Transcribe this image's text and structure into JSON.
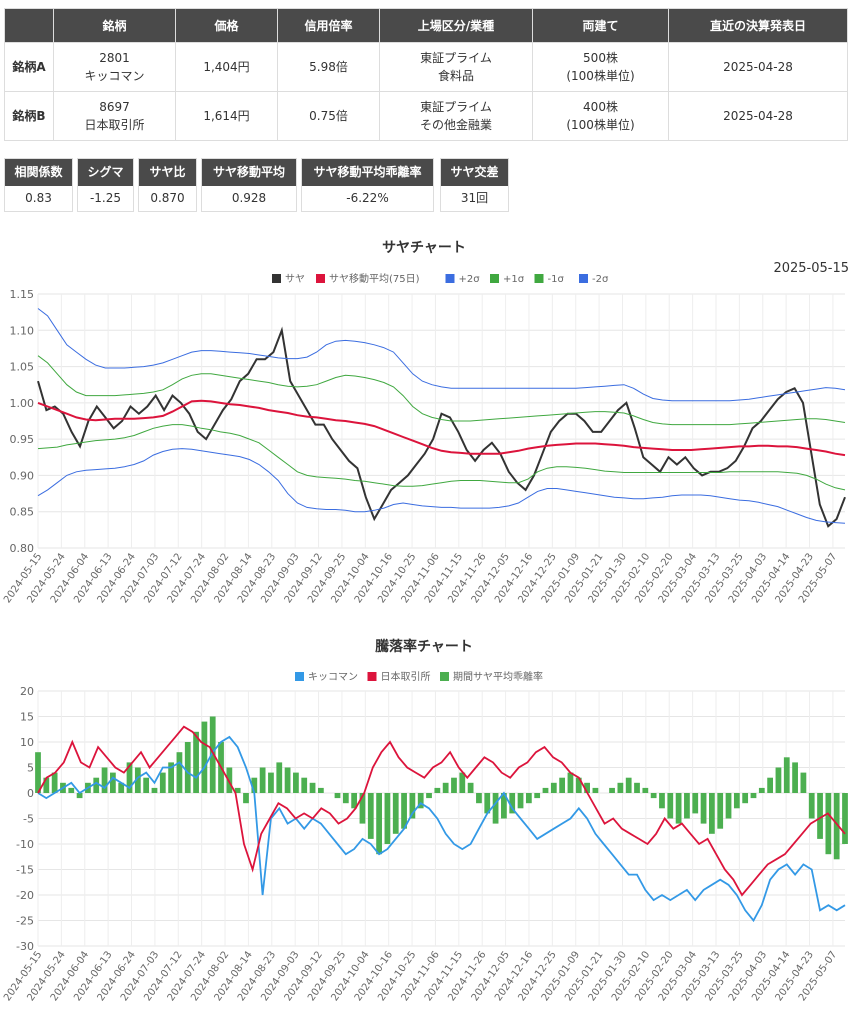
{
  "table": {
    "headers": [
      "",
      "銘柄",
      "価格",
      "信用倍率",
      "上場区分/業種",
      "両建て",
      "直近の決算発表日"
    ],
    "rows": [
      {
        "label": "銘柄A",
        "code": "2801",
        "name": "キッコマン",
        "price": "1,404円",
        "margin": "5.98倍",
        "market": "東証プライム",
        "sector": "食料品",
        "shares": "500株",
        "unit": "(100株単位)",
        "date": "2025-04-28"
      },
      {
        "label": "銘柄B",
        "code": "8697",
        "name": "日本取引所",
        "price": "1,614円",
        "margin": "0.75倍",
        "market": "東証プライム",
        "sector": "その他金融業",
        "shares": "400株",
        "unit": "(100株単位)",
        "date": "2025-04-28"
      }
    ]
  },
  "stats": [
    {
      "label": "相関係数",
      "value": "0.83"
    },
    {
      "label": "シグマ",
      "value": "-1.25"
    },
    {
      "label": "サヤ比",
      "value": "0.870"
    },
    {
      "label": "サヤ移動平均",
      "value": "0.928"
    },
    {
      "label": "サヤ移動平均乖離率",
      "value": "-6.22%"
    },
    {
      "label": "サヤ交差",
      "value": "31回"
    }
  ],
  "chart_data": [
    {
      "type": "line",
      "title": "サヤチャート",
      "date_label": "2025-05-15",
      "ylim": [
        0.8,
        1.15
      ],
      "yticks": [
        "0.80",
        "0.85",
        "0.90",
        "0.95",
        "1.00",
        "1.05",
        "1.10",
        "1.15"
      ],
      "x_labels": [
        "2024-05-15",
        "2024-05-24",
        "2024-06-04",
        "2024-06-13",
        "2024-06-24",
        "2024-07-03",
        "2024-07-12",
        "2024-07-24",
        "2024-08-02",
        "2024-08-14",
        "2024-08-23",
        "2024-09-03",
        "2024-09-12",
        "2024-09-25",
        "2024-10-04",
        "2024-10-16",
        "2024-10-25",
        "2024-11-06",
        "2024-11-15",
        "2024-11-26",
        "2024-12-05",
        "2024-12-16",
        "2024-12-25",
        "2025-01-09",
        "2025-01-21",
        "2025-01-30",
        "2025-02-10",
        "2025-02-20",
        "2025-03-04",
        "2025-03-13",
        "2025-03-25",
        "2025-04-03",
        "2025-04-14",
        "2025-04-23",
        "2025-05-07"
      ],
      "grid": true,
      "legend": "top",
      "series": [
        {
          "name": "サヤ",
          "color": "#333333",
          "values": [
            1.03,
            0.99,
            0.995,
            0.985,
            0.96,
            0.94,
            0.975,
            0.995,
            0.98,
            0.965,
            0.975,
            0.995,
            0.985,
            0.995,
            1.01,
            0.99,
            1.01,
            1.0,
            0.985,
            0.96,
            0.95,
            0.97,
            0.99,
            1.005,
            1.03,
            1.04,
            1.06,
            1.06,
            1.07,
            1.1,
            1.03,
            1.01,
            0.99,
            0.97,
            0.97,
            0.95,
            0.935,
            0.92,
            0.91,
            0.87,
            0.84,
            0.86,
            0.88,
            0.89,
            0.9,
            0.915,
            0.93,
            0.95,
            0.985,
            0.98,
            0.96,
            0.935,
            0.92,
            0.935,
            0.945,
            0.93,
            0.905,
            0.89,
            0.88,
            0.9,
            0.93,
            0.96,
            0.975,
            0.985,
            0.985,
            0.975,
            0.96,
            0.96,
            0.975,
            0.99,
            1.0,
            0.965,
            0.925,
            0.915,
            0.905,
            0.925,
            0.915,
            0.925,
            0.91,
            0.9,
            0.905,
            0.905,
            0.91,
            0.92,
            0.94,
            0.965,
            0.975,
            0.99,
            1.005,
            1.015,
            1.02,
            1.0,
            0.93,
            0.86,
            0.83,
            0.84,
            0.87
          ]
        },
        {
          "name": "サヤ移動平均(75日)",
          "color": "#dc143c",
          "values": [
            1.0,
            0.995,
            0.99,
            0.985,
            0.98,
            0.977,
            0.976,
            0.977,
            0.978,
            0.978,
            0.978,
            0.979,
            0.98,
            0.982,
            0.988,
            0.995,
            1.002,
            1.003,
            1.002,
            1.0,
            0.998,
            0.997,
            0.995,
            0.993,
            0.99,
            0.988,
            0.986,
            0.983,
            0.981,
            0.98,
            0.978,
            0.976,
            0.975,
            0.973,
            0.971,
            0.968,
            0.963,
            0.958,
            0.953,
            0.948,
            0.943,
            0.938,
            0.934,
            0.932,
            0.931,
            0.93,
            0.93,
            0.93,
            0.93,
            0.932,
            0.934,
            0.937,
            0.939,
            0.941,
            0.942,
            0.943,
            0.944,
            0.944,
            0.944,
            0.943,
            0.942,
            0.941,
            0.939,
            0.938,
            0.937,
            0.936,
            0.935,
            0.935,
            0.935,
            0.936,
            0.937,
            0.938,
            0.939,
            0.94,
            0.94,
            0.941,
            0.941,
            0.94,
            0.94,
            0.939,
            0.937,
            0.935,
            0.933,
            0.93,
            0.928
          ]
        },
        {
          "name": "+2σ",
          "color": "#3b6de0",
          "values": [
            1.13,
            1.12,
            1.1,
            1.08,
            1.07,
            1.06,
            1.052,
            1.048,
            1.048,
            1.048,
            1.049,
            1.05,
            1.052,
            1.055,
            1.06,
            1.065,
            1.07,
            1.072,
            1.072,
            1.071,
            1.07,
            1.069,
            1.068,
            1.066,
            1.064,
            1.062,
            1.061,
            1.061,
            1.063,
            1.07,
            1.08,
            1.085,
            1.086,
            1.085,
            1.083,
            1.08,
            1.076,
            1.07,
            1.055,
            1.04,
            1.03,
            1.025,
            1.022,
            1.02,
            1.02,
            1.02,
            1.02,
            1.02,
            1.02,
            1.02,
            1.02,
            1.02,
            1.02,
            1.02,
            1.02,
            1.02,
            1.02,
            1.021,
            1.022,
            1.023,
            1.024,
            1.025,
            1.02,
            1.012,
            1.006,
            1.004,
            1.003,
            1.003,
            1.003,
            1.003,
            1.003,
            1.003,
            1.003,
            1.004,
            1.005,
            1.007,
            1.009,
            1.011,
            1.013,
            1.015,
            1.017,
            1.019,
            1.021,
            1.02,
            1.018
          ]
        },
        {
          "name": "+1σ",
          "color": "#40a840",
          "values": [
            1.065,
            1.055,
            1.04,
            1.025,
            1.015,
            1.01,
            1.01,
            1.01,
            1.01,
            1.011,
            1.012,
            1.013,
            1.015,
            1.018,
            1.025,
            1.033,
            1.038,
            1.04,
            1.04,
            1.038,
            1.036,
            1.034,
            1.032,
            1.03,
            1.028,
            1.025,
            1.023,
            1.022,
            1.023,
            1.025,
            1.03,
            1.035,
            1.038,
            1.037,
            1.035,
            1.032,
            1.028,
            1.022,
            1.01,
            0.995,
            0.985,
            0.98,
            0.977,
            0.975,
            0.975,
            0.975,
            0.976,
            0.977,
            0.978,
            0.979,
            0.98,
            0.981,
            0.982,
            0.983,
            0.984,
            0.985,
            0.986,
            0.987,
            0.988,
            0.988,
            0.987,
            0.986,
            0.982,
            0.977,
            0.973,
            0.971,
            0.97,
            0.97,
            0.97,
            0.97,
            0.97,
            0.97,
            0.97,
            0.971,
            0.972,
            0.973,
            0.974,
            0.975,
            0.976,
            0.977,
            0.978,
            0.978,
            0.977,
            0.975,
            0.973
          ]
        },
        {
          "name": "-1σ",
          "color": "#40a840",
          "values": [
            0.937,
            0.938,
            0.939,
            0.942,
            0.944,
            0.946,
            0.948,
            0.949,
            0.95,
            0.952,
            0.955,
            0.96,
            0.965,
            0.968,
            0.97,
            0.97,
            0.968,
            0.965,
            0.963,
            0.96,
            0.958,
            0.955,
            0.95,
            0.945,
            0.935,
            0.925,
            0.915,
            0.905,
            0.9,
            0.898,
            0.897,
            0.896,
            0.895,
            0.893,
            0.892,
            0.89,
            0.888,
            0.886,
            0.885,
            0.885,
            0.886,
            0.888,
            0.89,
            0.892,
            0.893,
            0.893,
            0.893,
            0.892,
            0.891,
            0.89,
            0.89,
            0.895,
            0.905,
            0.91,
            0.912,
            0.912,
            0.911,
            0.91,
            0.908,
            0.906,
            0.905,
            0.904,
            0.904,
            0.904,
            0.904,
            0.904,
            0.904,
            0.904,
            0.904,
            0.904,
            0.904,
            0.904,
            0.905,
            0.905,
            0.905,
            0.905,
            0.905,
            0.905,
            0.904,
            0.903,
            0.9,
            0.895,
            0.888,
            0.883,
            0.88
          ]
        },
        {
          "name": "-2σ",
          "color": "#3b6de0",
          "values": [
            0.872,
            0.88,
            0.89,
            0.9,
            0.905,
            0.907,
            0.908,
            0.909,
            0.91,
            0.912,
            0.915,
            0.92,
            0.928,
            0.933,
            0.936,
            0.937,
            0.936,
            0.934,
            0.932,
            0.93,
            0.928,
            0.926,
            0.922,
            0.915,
            0.905,
            0.893,
            0.875,
            0.862,
            0.856,
            0.854,
            0.853,
            0.853,
            0.852,
            0.85,
            0.85,
            0.852,
            0.855,
            0.86,
            0.862,
            0.86,
            0.858,
            0.857,
            0.856,
            0.856,
            0.855,
            0.855,
            0.855,
            0.855,
            0.856,
            0.858,
            0.862,
            0.87,
            0.878,
            0.882,
            0.882,
            0.88,
            0.878,
            0.876,
            0.874,
            0.872,
            0.87,
            0.869,
            0.868,
            0.868,
            0.869,
            0.87,
            0.872,
            0.873,
            0.873,
            0.873,
            0.872,
            0.87,
            0.868,
            0.866,
            0.865,
            0.863,
            0.86,
            0.857,
            0.852,
            0.847,
            0.842,
            0.838,
            0.836,
            0.835,
            0.834
          ]
        }
      ]
    },
    {
      "type": "line",
      "title": "騰落率チャート",
      "ylim": [
        -30,
        20
      ],
      "yticks": [
        "-30",
        "-25",
        "-20",
        "-15",
        "-10",
        "-5",
        "0",
        "5",
        "10",
        "15",
        "20"
      ],
      "x_labels": [
        "2024-05-15",
        "2024-05-24",
        "2024-06-04",
        "2024-06-13",
        "2024-06-24",
        "2024-07-03",
        "2024-07-12",
        "2024-07-24",
        "2024-08-02",
        "2024-08-14",
        "2024-08-23",
        "2024-09-03",
        "2024-09-12",
        "2024-09-25",
        "2024-10-04",
        "2024-10-16",
        "2024-10-25",
        "2024-11-06",
        "2024-11-15",
        "2024-11-26",
        "2024-12-05",
        "2024-12-16",
        "2024-12-25",
        "2025-01-09",
        "2025-01-21",
        "2025-01-30",
        "2025-02-10",
        "2025-02-20",
        "2025-03-04",
        "2025-03-13",
        "2025-03-25",
        "2025-04-03",
        "2025-04-14",
        "2025-04-23",
        "2025-05-07"
      ],
      "grid": true,
      "legend": "top",
      "series": [
        {
          "name": "キッコマン",
          "color": "#3399e6",
          "values": [
            0,
            -1,
            0,
            1,
            2,
            0,
            1,
            2,
            1,
            3,
            2,
            1,
            3,
            4,
            2,
            5,
            5,
            6,
            4,
            3,
            5,
            8,
            10,
            11,
            9,
            5,
            0,
            -20,
            -5,
            -3,
            -6,
            -5,
            -7,
            -5,
            -6,
            -8,
            -10,
            -12,
            -11,
            -9,
            -10,
            -12,
            -11,
            -9,
            -7,
            -4,
            -2,
            -3,
            -5,
            -8,
            -10,
            -11,
            -10,
            -7,
            -4,
            -2,
            0,
            -3,
            -5,
            -7,
            -9,
            -8,
            -7,
            -6,
            -5,
            -3,
            -5,
            -8,
            -10,
            -12,
            -14,
            -16,
            -16,
            -19,
            -21,
            -20,
            -21,
            -20,
            -19,
            -21,
            -19,
            -18,
            -17,
            -18,
            -20,
            -23,
            -25,
            -22,
            -17,
            -15,
            -14,
            -16,
            -14,
            -15,
            -23,
            -22,
            -23,
            -22
          ]
        },
        {
          "name": "日本取引所",
          "color": "#dc143c",
          "values": [
            0,
            3,
            4,
            6,
            10,
            6,
            5,
            9,
            7,
            5,
            4,
            6,
            8,
            5,
            7,
            9,
            11,
            13,
            12,
            10,
            9,
            6,
            3,
            0,
            -10,
            -15,
            -8,
            -5,
            -2,
            -3,
            -5,
            -4,
            -5,
            -3,
            -4,
            -6,
            -5,
            -3,
            0,
            5,
            8,
            10,
            7,
            5,
            4,
            3,
            5,
            6,
            8,
            5,
            3,
            5,
            7,
            6,
            4,
            3,
            5,
            6,
            8,
            9,
            7,
            6,
            4,
            3,
            0,
            -3,
            -6,
            -5,
            -7,
            -8,
            -9,
            -10,
            -8,
            -5,
            -7,
            -6,
            -8,
            -10,
            -9,
            -12,
            -15,
            -17,
            -20,
            -18,
            -16,
            -14,
            -13,
            -12,
            -10,
            -8,
            -6,
            -5,
            -4,
            -6,
            -8
          ]
        },
        {
          "name": "期間サヤ平均乖離率",
          "color": "#4caf50",
          "type": "bar",
          "values": [
            8,
            3,
            4,
            2,
            1,
            -1,
            2,
            3,
            5,
            4,
            2,
            6,
            5,
            3,
            1,
            4,
            6,
            8,
            10,
            12,
            14,
            15,
            10,
            5,
            1,
            -2,
            3,
            5,
            4,
            6,
            5,
            4,
            3,
            2,
            1,
            0,
            -1,
            -2,
            -3,
            -6,
            -9,
            -12,
            -10,
            -8,
            -7,
            -5,
            -3,
            -1,
            1,
            2,
            3,
            4,
            2,
            -2,
            -4,
            -6,
            -5,
            -4,
            -3,
            -2,
            -1,
            1,
            2,
            3,
            4,
            3,
            2,
            1,
            0,
            1,
            2,
            3,
            2,
            1,
            -1,
            -3,
            -5,
            -6,
            -5,
            -4,
            -6,
            -8,
            -7,
            -5,
            -3,
            -2,
            -1,
            1,
            3,
            5,
            7,
            6,
            4,
            -5,
            -9,
            -12,
            -13,
            -10
          ]
        }
      ]
    }
  ]
}
